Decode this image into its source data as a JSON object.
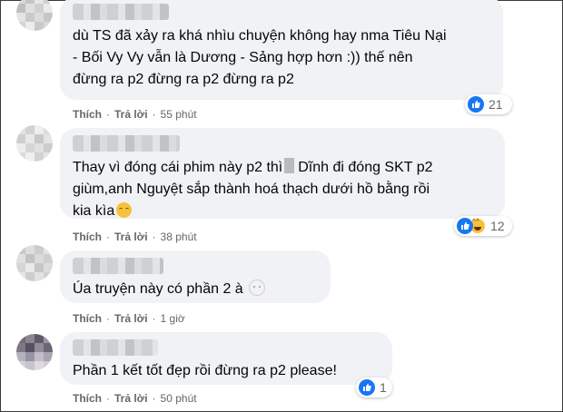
{
  "comments": [
    {
      "text_lines": [
        "dù TS đã xảy ra khá nhìu chuyện không hay nma Tiêu Nại",
        "- Bối Vy Vy vẫn là Dương - Sảng hợp hơn :)) thế nên",
        "đừng ra p2 đừng ra p2 đừng ra p2"
      ],
      "reaction": {
        "types": [
          "like-icon"
        ],
        "count": "21"
      },
      "actions": {
        "like": "Thích",
        "reply": "Trả lời",
        "time": "55 phút"
      }
    },
    {
      "text_lines": [
        "Thay vì đóng cái phim này p2 thì",
        "Dĩnh đi đóng SKT p2",
        "giùm,anh Nguyệt sắp thành hoá thạch dưới hồ bằng rồi",
        "kia kìa"
      ],
      "emoji": "relieved-face-icon",
      "reaction": {
        "types": [
          "like-icon",
          "haha-icon"
        ],
        "count": "12"
      },
      "actions": {
        "like": "Thích",
        "reply": "Trả lời",
        "time": "38 phút"
      }
    },
    {
      "text_lines": [
        "Úa truyện này có phần 2 à"
      ],
      "emoji": "moon-face-icon",
      "actions": {
        "like": "Thích",
        "reply": "Trả lời",
        "time": "1 giờ"
      }
    },
    {
      "text_lines": [
        "Phần 1 kết tốt đẹp rồi đừng ra p2 please!"
      ],
      "reaction": {
        "types": [
          "like-icon"
        ],
        "count": "1"
      },
      "actions": {
        "like": "Thích",
        "reply": "Trả lời",
        "time": "50 phút"
      }
    }
  ],
  "separator": "·",
  "colors": {
    "bubble": "#f0f2f5",
    "like_blue": "#1877f2",
    "meta_gray": "#65676b"
  }
}
